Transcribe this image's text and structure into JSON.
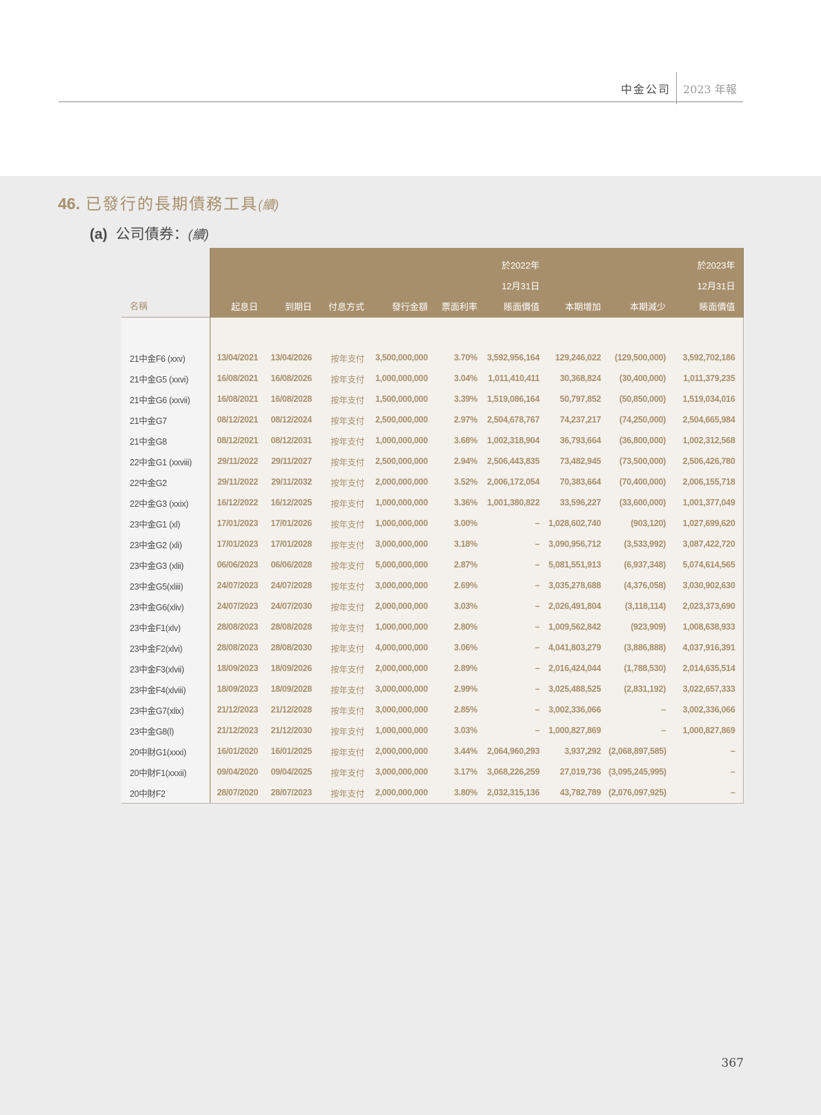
{
  "header": {
    "company": "中金公司",
    "report": "2023 年報"
  },
  "section": {
    "number": "46.",
    "title": "已發行的長期債務工具",
    "continued": "(續)"
  },
  "subsection": {
    "letter": "(a)",
    "title": "公司債券：",
    "continued": "(續)"
  },
  "table": {
    "headers": {
      "name": "名稱",
      "start": "起息日",
      "maturity": "到期日",
      "method": "付息方式",
      "amount": "發行金額",
      "rate": "票面利率",
      "open_l1": "於2022年",
      "open_l2": "12月31日",
      "open_l3": "賬面價值",
      "increase": "本期增加",
      "decrease": "本期減少",
      "close_l1": "於2023年",
      "close_l2": "12月31日",
      "close_l3": "賬面價值"
    },
    "rows": [
      [
        "21中金F6 (xxv)",
        "13/04/2021",
        "13/04/2026",
        "按年支付",
        "3,500,000,000",
        "3.70%",
        "3,592,956,164",
        "129,246,022",
        "(129,500,000)",
        "3,592,702,186"
      ],
      [
        "21中金G5 (xxvi)",
        "16/08/2021",
        "16/08/2026",
        "按年支付",
        "1,000,000,000",
        "3.04%",
        "1,011,410,411",
        "30,368,824",
        "(30,400,000)",
        "1,011,379,235"
      ],
      [
        "21中金G6 (xxvii)",
        "16/08/2021",
        "16/08/2028",
        "按年支付",
        "1,500,000,000",
        "3.39%",
        "1,519,086,164",
        "50,797,852",
        "(50,850,000)",
        "1,519,034,016"
      ],
      [
        "21中金G7",
        "08/12/2021",
        "08/12/2024",
        "按年支付",
        "2,500,000,000",
        "2.97%",
        "2,504,678,767",
        "74,237,217",
        "(74,250,000)",
        "2,504,665,984"
      ],
      [
        "21中金G8",
        "08/12/2021",
        "08/12/2031",
        "按年支付",
        "1,000,000,000",
        "3.68%",
        "1,002,318,904",
        "36,793,664",
        "(36,800,000)",
        "1,002,312,568"
      ],
      [
        "22中金G1 (xxviii)",
        "29/11/2022",
        "29/11/2027",
        "按年支付",
        "2,500,000,000",
        "2.94%",
        "2,506,443,835",
        "73,482,945",
        "(73,500,000)",
        "2,506,426,780"
      ],
      [
        "22中金G2",
        "29/11/2022",
        "29/11/2032",
        "按年支付",
        "2,000,000,000",
        "3.52%",
        "2,006,172,054",
        "70,383,664",
        "(70,400,000)",
        "2,006,155,718"
      ],
      [
        "22中金G3 (xxix)",
        "16/12/2022",
        "16/12/2025",
        "按年支付",
        "1,000,000,000",
        "3.36%",
        "1,001,380,822",
        "33,596,227",
        "(33,600,000)",
        "1,001,377,049"
      ],
      [
        "23中金G1 (xl)",
        "17/01/2023",
        "17/01/2026",
        "按年支付",
        "1,000,000,000",
        "3.00%",
        "–",
        "1,028,602,740",
        "(903,120)",
        "1,027,699,620"
      ],
      [
        "23中金G2 (xli)",
        "17/01/2023",
        "17/01/2028",
        "按年支付",
        "3,000,000,000",
        "3.18%",
        "–",
        "3,090,956,712",
        "(3,533,992)",
        "3,087,422,720"
      ],
      [
        "23中金G3 (xlii)",
        "06/06/2023",
        "06/06/2028",
        "按年支付",
        "5,000,000,000",
        "2.87%",
        "–",
        "5,081,551,913",
        "(6,937,348)",
        "5,074,614,565"
      ],
      [
        "23中金G5(xliii)",
        "24/07/2023",
        "24/07/2028",
        "按年支付",
        "3,000,000,000",
        "2.69%",
        "–",
        "3,035,278,688",
        "(4,376,058)",
        "3,030,902,630"
      ],
      [
        "23中金G6(xliv)",
        "24/07/2023",
        "24/07/2030",
        "按年支付",
        "2,000,000,000",
        "3.03%",
        "–",
        "2,026,491,804",
        "(3,118,114)",
        "2,023,373,690"
      ],
      [
        "23中金F1(xlv)",
        "28/08/2023",
        "28/08/2028",
        "按年支付",
        "1,000,000,000",
        "2.80%",
        "–",
        "1,009,562,842",
        "(923,909)",
        "1,008,638,933"
      ],
      [
        "23中金F2(xlvi)",
        "28/08/2023",
        "28/08/2030",
        "按年支付",
        "4,000,000,000",
        "3.06%",
        "–",
        "4,041,803,279",
        "(3,886,888)",
        "4,037,916,391"
      ],
      [
        "23中金F3(xlvii)",
        "18/09/2023",
        "18/09/2026",
        "按年支付",
        "2,000,000,000",
        "2.89%",
        "–",
        "2,016,424,044",
        "(1,788,530)",
        "2,014,635,514"
      ],
      [
        "23中金F4(xlviii)",
        "18/09/2023",
        "18/09/2028",
        "按年支付",
        "3,000,000,000",
        "2.99%",
        "–",
        "3,025,488,525",
        "(2,831,192)",
        "3,022,657,333"
      ],
      [
        "23中金G7(xlix)",
        "21/12/2023",
        "21/12/2028",
        "按年支付",
        "3,000,000,000",
        "2.85%",
        "–",
        "3,002,336,066",
        "–",
        "3,002,336,066"
      ],
      [
        "23中金G8(l)",
        "21/12/2023",
        "21/12/2030",
        "按年支付",
        "1,000,000,000",
        "3.03%",
        "–",
        "1,000,827,869",
        "–",
        "1,000,827,869"
      ],
      [
        "20中財G1(xxxi)",
        "16/01/2020",
        "16/01/2025",
        "按年支付",
        "2,000,000,000",
        "3.44%",
        "2,064,960,293",
        "3,937,292",
        "(2,068,897,585)",
        "–"
      ],
      [
        "20中財F1(xxxii)",
        "09/04/2020",
        "09/04/2025",
        "按年支付",
        "3,000,000,000",
        "3.17%",
        "3,068,226,259",
        "27,019,736",
        "(3,095,245,995)",
        "–"
      ],
      [
        "20中財F2",
        "28/07/2020",
        "28/07/2023",
        "按年支付",
        "2,000,000,000",
        "3.80%",
        "2,032,315,136",
        "43,782,789",
        "(2,076,097,925)",
        "–"
      ]
    ]
  },
  "page_number": "367"
}
